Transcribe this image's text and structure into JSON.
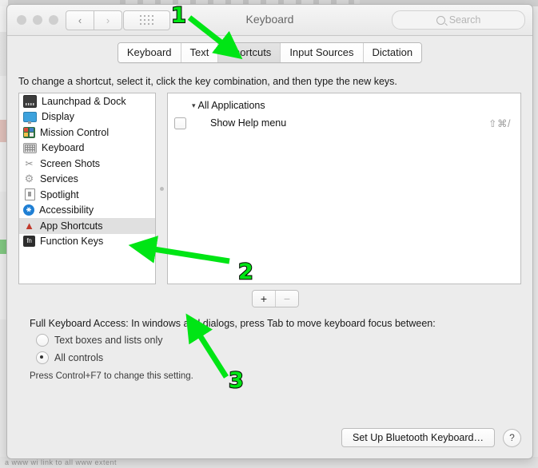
{
  "window": {
    "title": "Keyboard",
    "traffic_lights": [
      "close",
      "minimize",
      "zoom"
    ],
    "nav_back": "‹",
    "nav_forward": "›",
    "grid_button": "show-all",
    "search_placeholder": "Search"
  },
  "tabs": [
    {
      "label": "Keyboard",
      "selected": false
    },
    {
      "label": "Text",
      "selected": false
    },
    {
      "label": "Shortcuts",
      "selected": true
    },
    {
      "label": "Input Sources",
      "selected": false
    },
    {
      "label": "Dictation",
      "selected": false
    }
  ],
  "instructions": "To change a shortcut, select it, click the key combination, and then type the new keys.",
  "sidebar": {
    "items": [
      {
        "label": "Launchpad & Dock",
        "icon": "dock-icon",
        "selected": false
      },
      {
        "label": "Display",
        "icon": "display-icon",
        "selected": false
      },
      {
        "label": "Mission Control",
        "icon": "mission-control-icon",
        "selected": false
      },
      {
        "label": "Keyboard",
        "icon": "keyboard-icon",
        "selected": false
      },
      {
        "label": "Screen Shots",
        "icon": "screenshot-icon",
        "selected": false
      },
      {
        "label": "Services",
        "icon": "gear-icon",
        "selected": false
      },
      {
        "label": "Spotlight",
        "icon": "document-icon",
        "selected": false
      },
      {
        "label": "Accessibility",
        "icon": "accessibility-icon",
        "selected": false
      },
      {
        "label": "App Shortcuts",
        "icon": "app-shortcuts-icon",
        "selected": true
      },
      {
        "label": "Function Keys",
        "icon": "fn-key-icon",
        "selected": false
      }
    ]
  },
  "shortcuts_pane": {
    "group": {
      "disclosure": "▾",
      "label": "All Applications"
    },
    "rows": [
      {
        "checked": false,
        "name": "Show Help menu",
        "keys": "⇧⌘/"
      }
    ]
  },
  "add_remove": {
    "add_label": "+",
    "remove_label": "−"
  },
  "full_keyboard_access": {
    "label": "Full Keyboard Access: In windows and dialogs, press Tab to move keyboard focus between:",
    "options": [
      {
        "label": "Text boxes and lists only",
        "selected": false
      },
      {
        "label": "All controls",
        "selected": true
      }
    ],
    "note": "Press Control+F7 to change this setting."
  },
  "bottom": {
    "bluetooth_button": "Set Up Bluetooth Keyboard…",
    "help_button": "?"
  },
  "annotations": [
    {
      "number": "1",
      "target": "shortcuts-tab"
    },
    {
      "number": "2",
      "target": "app-shortcuts-sidebar-item"
    },
    {
      "number": "3",
      "target": "add-shortcut-button"
    }
  ],
  "background": {
    "bottom_text": "a www wi  link to  all  www extent"
  },
  "colors": {
    "annotation_green": "#00e515",
    "window_background": "#ececec",
    "selected_row": "#e0e0e0",
    "accent_blue": "#1f7fd4"
  }
}
